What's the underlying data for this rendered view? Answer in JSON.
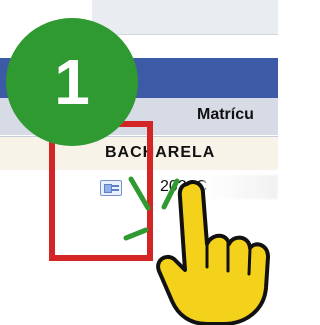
{
  "step": {
    "number": "1"
  },
  "table": {
    "column_header": "Matrícu",
    "group_label": "BACHARELA",
    "row_value": "2021C"
  },
  "icons": {
    "details": "details-card-icon",
    "tap_pointer": "tap-pointer-icon"
  },
  "colors": {
    "badge": "#2f9a31",
    "highlight": "#d32525",
    "header_bar": "#3d5aa7"
  }
}
